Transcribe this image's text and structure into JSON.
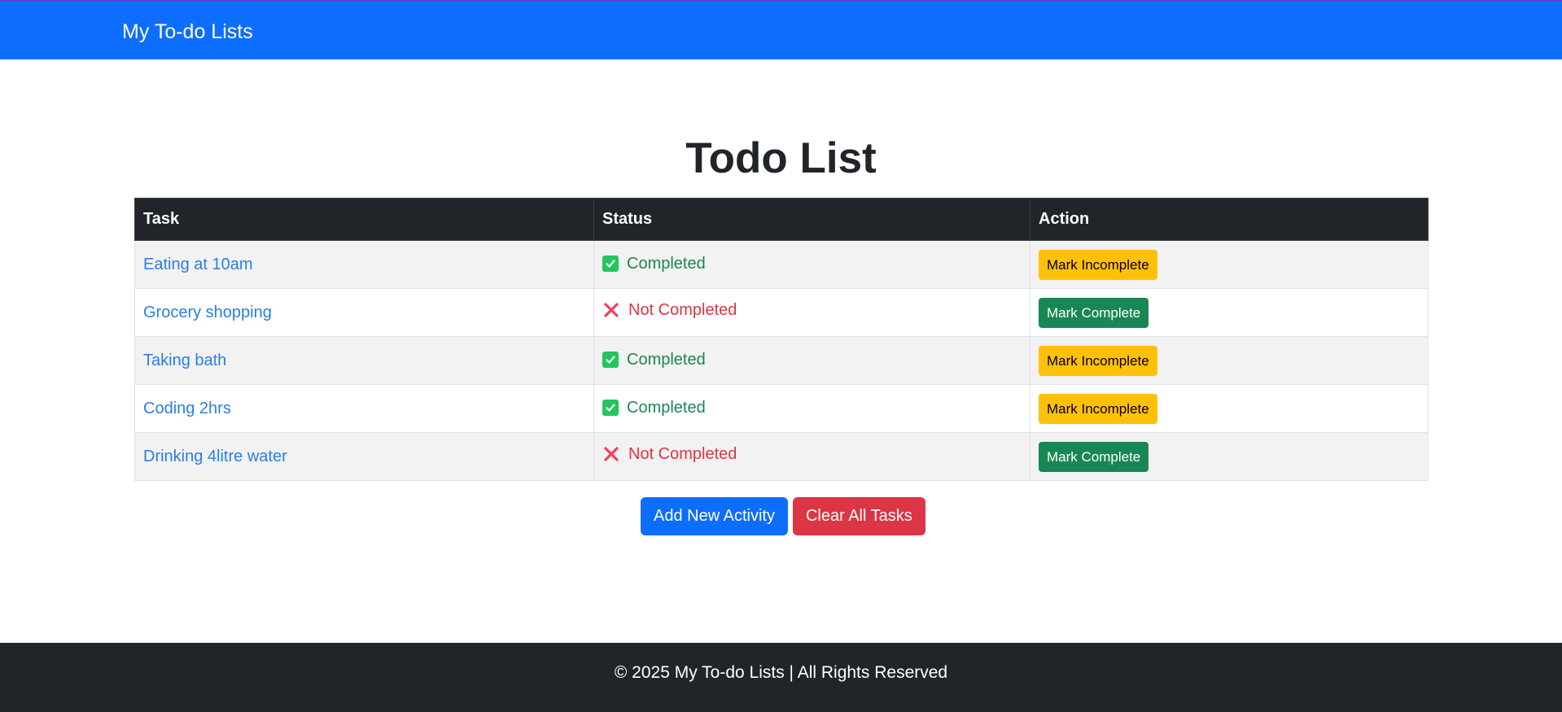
{
  "navbar": {
    "brand": "My To-do Lists"
  },
  "page_title": "Todo List",
  "table": {
    "headers": {
      "task": "Task",
      "status": "Status",
      "action": "Action"
    },
    "rows": [
      {
        "task": "Eating at 10am",
        "status": "Completed",
        "action": "Mark Incomplete"
      },
      {
        "task": "Grocery shopping",
        "status": "Not Completed",
        "action": "Mark Complete"
      },
      {
        "task": "Taking bath",
        "status": "Completed",
        "action": "Mark Incomplete"
      },
      {
        "task": "Coding 2hrs",
        "status": "Completed",
        "action": "Mark Incomplete"
      },
      {
        "task": "Drinking 4litre water",
        "status": "Not Completed",
        "action": "Mark Complete"
      }
    ]
  },
  "buttons": {
    "add": "Add New Activity",
    "clear": "Clear All Tasks"
  },
  "footer": {
    "text": "© 2025 My To-do Lists | All Rights Reserved"
  },
  "colors": {
    "navbar": "#0d6efd",
    "table_header": "#212529",
    "completed": "#198754",
    "not_completed": "#dc3545",
    "mark_incomplete_button": "#ffc107",
    "mark_complete_button": "#198754",
    "add_button": "#0d6efd",
    "clear_button": "#dc3545",
    "footer": "#212529"
  },
  "icons": {
    "completed": "check-box-icon",
    "not_completed": "cross-icon"
  }
}
